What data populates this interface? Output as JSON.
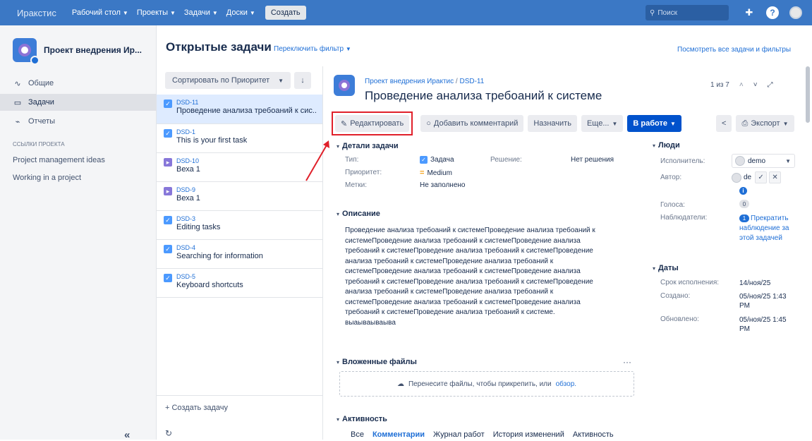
{
  "topnav": {
    "brand": "Иракстис",
    "items": [
      "Рабочий стол",
      "Проекты",
      "Задачи",
      "Доски"
    ],
    "create": "Создать",
    "search_placeholder": "Поиск"
  },
  "sidebar": {
    "project_name": "Проект внедрения Ир...",
    "items": [
      {
        "label": "Общие",
        "icon": "activity-icon"
      },
      {
        "label": "Задачи",
        "icon": "tasks-icon"
      },
      {
        "label": "Отчеты",
        "icon": "chart-icon"
      }
    ],
    "section_title": "ССЫЛКИ ПРОЕКТА",
    "links": [
      "Project management ideas",
      "Working in a project"
    ]
  },
  "page": {
    "title": "Открытые задачи",
    "switch_filter": "Переключить фильтр",
    "view_all": "Посмотреть все задачи и фильтры"
  },
  "list": {
    "sort_label": "Сортировать по Приоритет",
    "tasks": [
      {
        "key": "DSD-11",
        "summary": "Проведение анализа требоаний к сис...",
        "type": "task"
      },
      {
        "key": "DSD-1",
        "summary": "This is your first task",
        "type": "task"
      },
      {
        "key": "DSD-10",
        "summary": "Веха 1",
        "type": "milestone"
      },
      {
        "key": "DSD-9",
        "summary": "Веха 1",
        "type": "milestone"
      },
      {
        "key": "DSD-3",
        "summary": "Editing tasks",
        "type": "task"
      },
      {
        "key": "DSD-4",
        "summary": "Searching for information",
        "type": "task"
      },
      {
        "key": "DSD-5",
        "summary": "Keyboard shortcuts",
        "type": "task"
      }
    ],
    "create_task": "+ Создать задачу"
  },
  "detail": {
    "breadcrumb_project": "Проект внедрения Ирактис",
    "breadcrumb_key": "DSD-11",
    "title": "Проведение анализа требоаний к системе",
    "pager": "1 из 7",
    "toolbar": {
      "edit": "Редактировать",
      "comment": "Добавить комментарий",
      "assign": "Назначить",
      "more": "Еще...",
      "status": "В работе",
      "export": "Экспорт"
    },
    "details": {
      "heading": "Детали задачи",
      "type_label": "Тип:",
      "type_value": "Задача",
      "resolution_label": "Решение:",
      "resolution_value": "Нет решения",
      "priority_label": "Приоритет:",
      "priority_value": "Medium",
      "labels_label": "Метки:",
      "labels_value": "Не заполнено"
    },
    "description": {
      "heading": "Описание",
      "text": "Проведение анализа требоаний к системеПроведение анализа требоаний к системеПроведение анализа требоаний к системеПроведение анализа требоаний к системеПроведение анализа требоаний к системеПроведение анализа требоаний к системеПроведение анализа требоаний к системеПроведение анализа требоаний к системеПроведение анализа требоаний к системеПроведение анализа требоаний к системеПроведение анализа требоаний к системеПроведение анализа требоаний к системеПроведение анализа требоаний к системеПроведение анализа требоаний к системеПроведение анализа требоаний к системе.",
      "extra": "выаываываыва"
    },
    "attachments": {
      "heading": "Вложенные файлы",
      "drop_text": "Перенесите файлы, чтобы прикрепить, или",
      "browse": "обзор."
    },
    "activity": {
      "heading": "Активность",
      "tabs": [
        "Все",
        "Комментарии",
        "Журнал работ",
        "История изменений",
        "Активность"
      ]
    },
    "people": {
      "heading": "Люди",
      "assignee_label": "Исполнитель:",
      "assignee_value": "demo",
      "author_label": "Автор:",
      "author_value": "de",
      "votes_label": "Голоса:",
      "votes_value": "0",
      "watchers_label": "Наблюдатели:",
      "watchers_count": "1",
      "watchers_action": "Прекратить наблюдение за этой задачей"
    },
    "dates": {
      "heading": "Даты",
      "due_label": "Срок исполнения:",
      "due_value": "14/ноя/25",
      "created_label": "Создано:",
      "created_value": "05/ноя/25 1:43 PM",
      "updated_label": "Обновлено:",
      "updated_value": "05/ноя/25 1:45 PM"
    }
  },
  "colors": {
    "topnav": "#3b78c5",
    "primary": "#0052cc",
    "link": "#1f6fd6",
    "highlight": "#e0202a"
  }
}
